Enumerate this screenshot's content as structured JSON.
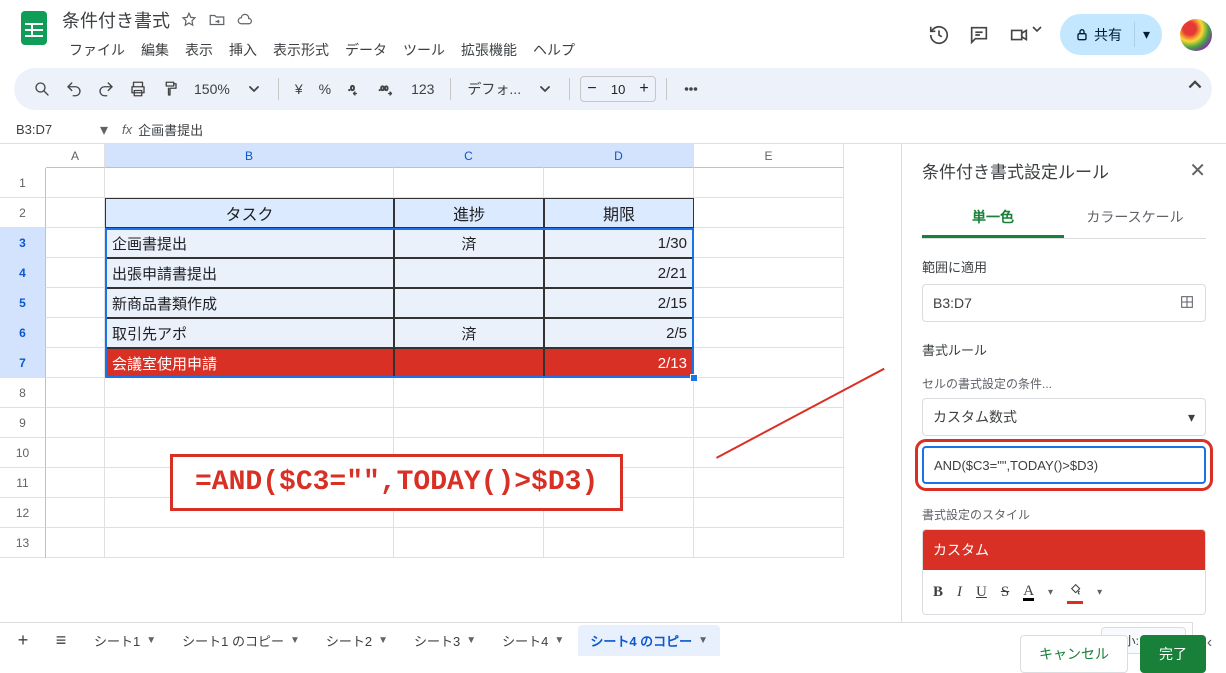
{
  "doc": {
    "title": "条件付き書式"
  },
  "menus": [
    "ファイル",
    "編集",
    "表示",
    "挿入",
    "表示形式",
    "データ",
    "ツール",
    "拡張機能",
    "ヘルプ"
  ],
  "share": {
    "label": "共有"
  },
  "toolbar": {
    "zoom": "150%",
    "currency": "¥",
    "percent": "%",
    "dec_dec": ".0←",
    "dec_inc": ".00→",
    "num123": "123",
    "font": "デフォ...",
    "font_size": "10"
  },
  "namebox": {
    "ref": "B3:D7",
    "formula": "企画書提出"
  },
  "columns": [
    "A",
    "B",
    "C",
    "D",
    "E"
  ],
  "col_sel": [
    "B",
    "C",
    "D"
  ],
  "row_headers": [
    1,
    2,
    3,
    4,
    5,
    6,
    7,
    8,
    9,
    10,
    11,
    12,
    13
  ],
  "row_sel": [
    3,
    4,
    5,
    6,
    7
  ],
  "table": {
    "headers": [
      "タスク",
      "進捗",
      "期限"
    ],
    "rows": [
      {
        "task": "企画書提出",
        "status": "済",
        "due": "1/30",
        "red": false
      },
      {
        "task": "出張申請書提出",
        "status": "",
        "due": "2/21",
        "red": false
      },
      {
        "task": "新商品書類作成",
        "status": "",
        "due": "2/15",
        "red": false
      },
      {
        "task": "取引先アポ",
        "status": "済",
        "due": "2/5",
        "red": false
      },
      {
        "task": "会議室使用申請",
        "status": "",
        "due": "2/13",
        "red": true
      }
    ]
  },
  "annotation": {
    "formula_display": "=AND($C3=\"\",TODAY()>$D3)"
  },
  "sidepanel": {
    "title": "条件付き書式設定ルール",
    "tab_single": "単一色",
    "tab_scale": "カラースケール",
    "range_label": "範囲に適用",
    "range_value": "B3:D7",
    "rule_label": "書式ルール",
    "condition_label": "セルの書式設定の条件...",
    "condition_value": "カスタム数式",
    "formula_value": "AND($C3=\"\",TODAY()>$D3)",
    "style_label": "書式設定のスタイル",
    "style_name": "カスタム",
    "cancel": "キャンセル",
    "done": "完了"
  },
  "sheets": [
    {
      "name": "シート1",
      "active": false
    },
    {
      "name": "シート1 のコピー",
      "active": false
    },
    {
      "name": "シート2",
      "active": false
    },
    {
      "name": "シート3",
      "active": false
    },
    {
      "name": "シート4",
      "active": false
    },
    {
      "name": "シート4 のコピー",
      "active": true
    }
  ],
  "footer": {
    "add": "+",
    "all": "≡",
    "zoom_info": "最小: 1/30"
  }
}
